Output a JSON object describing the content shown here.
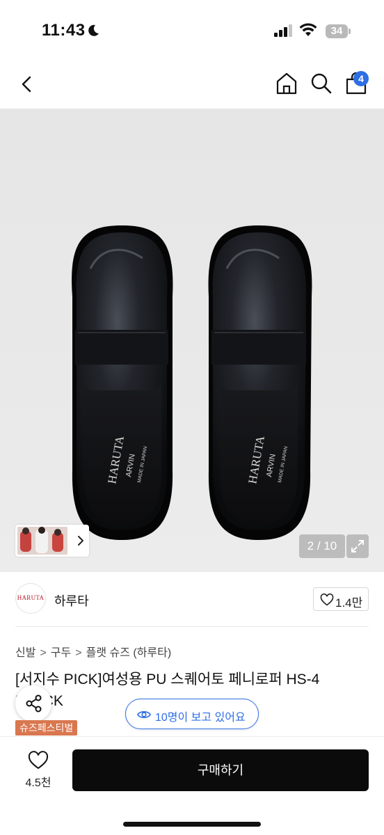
{
  "status_bar": {
    "time": "11:43",
    "battery": "34",
    "battery_level": 0.34,
    "icons": [
      "moon-icon",
      "signal-icon",
      "wifi-icon",
      "battery-icon"
    ]
  },
  "nav": {
    "cart_count": "4",
    "icons": [
      "chevron-left-icon",
      "home-icon",
      "search-icon",
      "cart-icon"
    ]
  },
  "gallery": {
    "counter": "2 / 10",
    "brand_print_1": "HARUTA",
    "brand_print_2": "ARVIN",
    "brand_print_3": "MADE IN JAPAN"
  },
  "seller": {
    "logo_text": "HARUTA",
    "name": "하루타",
    "like_count": "1.4만"
  },
  "breadcrumb": [
    "신발",
    "구두",
    "플랫 슈즈 (하루타)"
  ],
  "product": {
    "title": "[서지수 PICK]여성용 PU 스퀘어토 페니로퍼 HS-4 BLACK",
    "viewers": "10명이 보고 있어요",
    "event_badge": "슈즈페스티벌"
  },
  "bottom_bar": {
    "wish_count": "4.5천",
    "buy_label": "구매하기"
  },
  "colors": {
    "accent": "#2f6fe4",
    "buy_button": "#0b0b0b",
    "event_badge": "#d9774f",
    "image_bg": "#e8e8e8"
  }
}
